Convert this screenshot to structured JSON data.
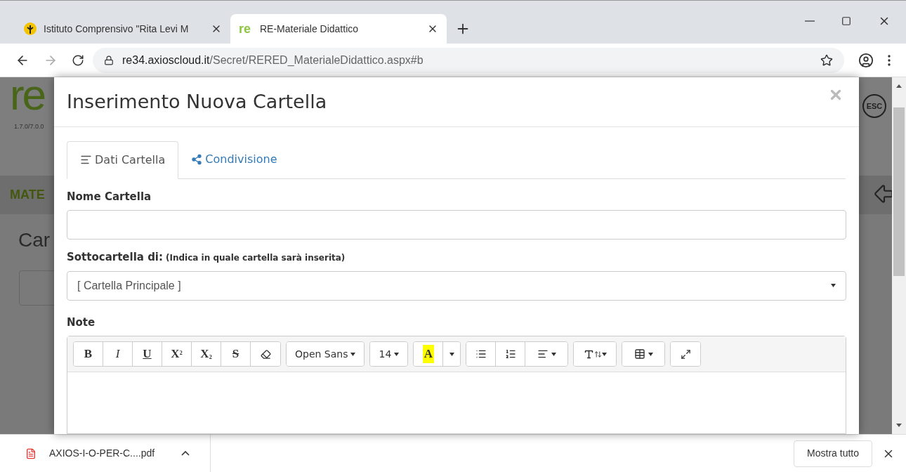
{
  "browser": {
    "tabs": [
      {
        "title": "Istituto Comprensivo \"Rita Levi M",
        "selected": false
      },
      {
        "favicon": "re",
        "title": "RE-Materiale Didattico",
        "selected": true
      }
    ],
    "url": {
      "host": "re34.axioscloud.it",
      "path": "/Secret/RERED_MaterialeDidattico.aspx#b"
    }
  },
  "page": {
    "logo": "re",
    "version": "1.7.0/7.0.0",
    "menu_label": "MATE",
    "heading": "Car",
    "esc_label": "ESC"
  },
  "modal": {
    "title": "Inserimento Nuova Cartella",
    "tabs": [
      {
        "label": "Dati Cartella",
        "kind": "lines",
        "selected": true
      },
      {
        "label": "Condivisione",
        "kind": "share",
        "selected": false
      }
    ],
    "fields": [
      {
        "kind": "text",
        "label": "Nome Cartella"
      },
      {
        "kind": "select",
        "label": "Sottocartella di:",
        "hint": "(Indica in quale cartella sarà inserita)",
        "value": "[ Cartella Principale ]"
      }
    ],
    "note": {
      "label": "Note",
      "toolbar": [
        [
          {
            "kind": "bold",
            "label": "B"
          },
          {
            "kind": "italic",
            "label": "I"
          },
          {
            "kind": "underline",
            "label": "U"
          },
          {
            "kind": "rich",
            "label": "X$^{2}$"
          },
          {
            "kind": "rich",
            "label": "X$_{2}$"
          },
          {
            "kind": "strike",
            "label": "S"
          },
          {
            "kind": "eraser"
          }
        ],
        [
          {
            "kind": "dropdown",
            "label": "Open Sans"
          }
        ],
        [
          {
            "kind": "dropdown",
            "label": "14"
          }
        ],
        [
          {
            "kind": "highlight",
            "label": "A"
          },
          {
            "kind": "caret"
          }
        ],
        [
          {
            "kind": "bullets"
          },
          {
            "kind": "numbers"
          },
          {
            "kind": "align"
          }
        ],
        [
          {
            "kind": "lineheight"
          }
        ],
        [
          {
            "kind": "table"
          }
        ],
        [
          {
            "kind": "fullscreen"
          }
        ]
      ]
    }
  },
  "downloads": {
    "file": "AXIOS-I-O-PER-C....pdf",
    "show_all": "Mostra tutto"
  }
}
